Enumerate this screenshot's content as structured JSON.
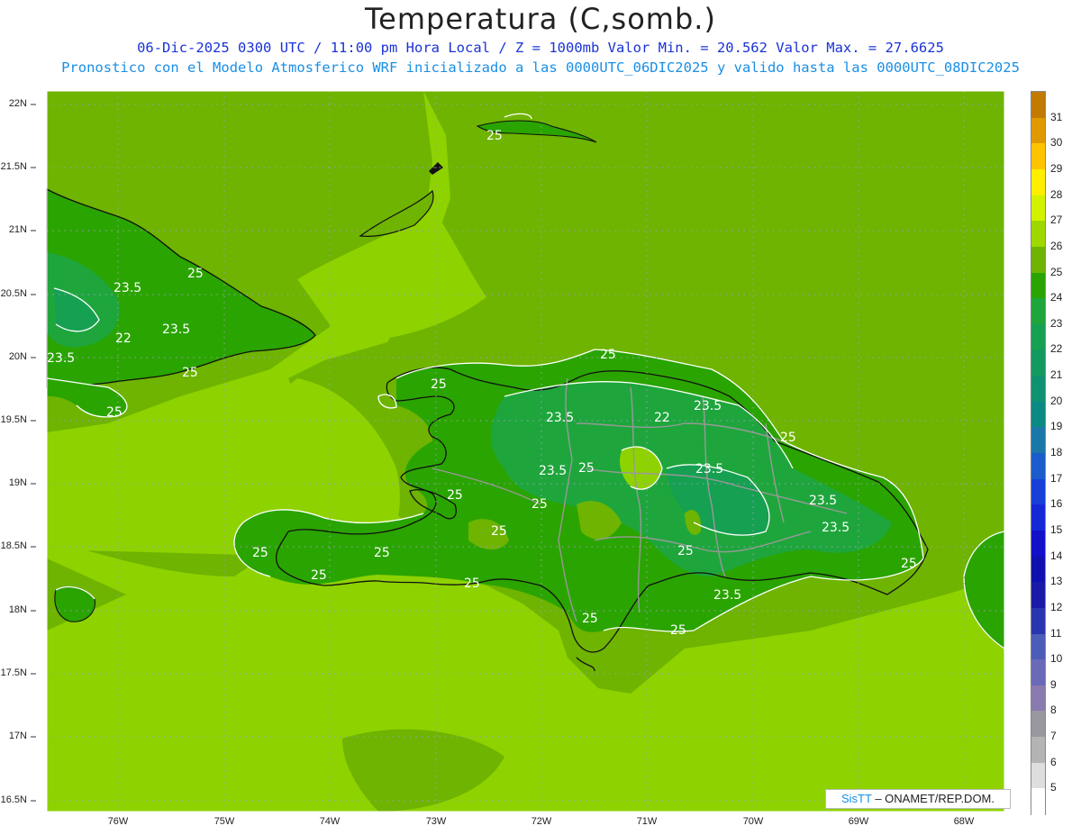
{
  "header": {
    "title": "Temperatura (C,somb.)",
    "line1": "06-Dic-2025 0300 UTC / 11:00 pm Hora Local / Z = 1000mb   Valor Min. = 20.562  Valor Max. = 27.6625",
    "line2": "Pronostico con el Modelo Atmosferico WRF inicializado a las 0000UTC_06DIC2025 y valido hasta las  0000UTC_08DIC2025"
  },
  "latitude_labels": [
    "22N",
    "21.5N",
    "21N",
    "20.5N",
    "20N",
    "19.5N",
    "19N",
    "18.5N",
    "18N",
    "17.5N",
    "17N",
    "16.5N"
  ],
  "longitude_labels": [
    "76W",
    "75W",
    "74W",
    "73W",
    "72W",
    "71W",
    "70W",
    "69W",
    "68W"
  ],
  "colorbar": {
    "labels": [
      "31",
      "30",
      "29",
      "28",
      "27",
      "26",
      "25",
      "24",
      "23",
      "22",
      "21",
      "20",
      "19",
      "18",
      "17",
      "16",
      "15",
      "14",
      "13",
      "12",
      "11",
      "10",
      "9",
      "8",
      "7",
      "6",
      "5"
    ],
    "colors": [
      "#c27a00",
      "#e09a00",
      "#ffc400",
      "#ffee00",
      "#d2f200",
      "#9ed800",
      "#6eb400",
      "#2aa400",
      "#1ea63c",
      "#16a052",
      "#129a60",
      "#0e9270",
      "#0a8a82",
      "#1a78a8",
      "#1a5ccc",
      "#1840d8",
      "#1428d8",
      "#1210c8",
      "#1010b0",
      "#1a1aa8",
      "#2a34b0",
      "#4c5cb8",
      "#6a6ab8",
      "#8a7ab0",
      "#9898a0",
      "#b4b4b4",
      "#dedede",
      "#ffffff"
    ]
  },
  "contour_labels": [
    "25",
    "25",
    "23.5",
    "23.5",
    "22",
    "23.5",
    "25",
    "25",
    "25",
    "25",
    "23.5",
    "22",
    "23.5",
    "25",
    "23.5",
    "25",
    "23.5",
    "23.5",
    "25",
    "25",
    "25",
    "25",
    "25",
    "25",
    "23.5",
    "25",
    "25",
    "25",
    "25"
  ],
  "credit": {
    "brand": "SisTT",
    "org": "ONAMET/REP.DOM."
  }
}
